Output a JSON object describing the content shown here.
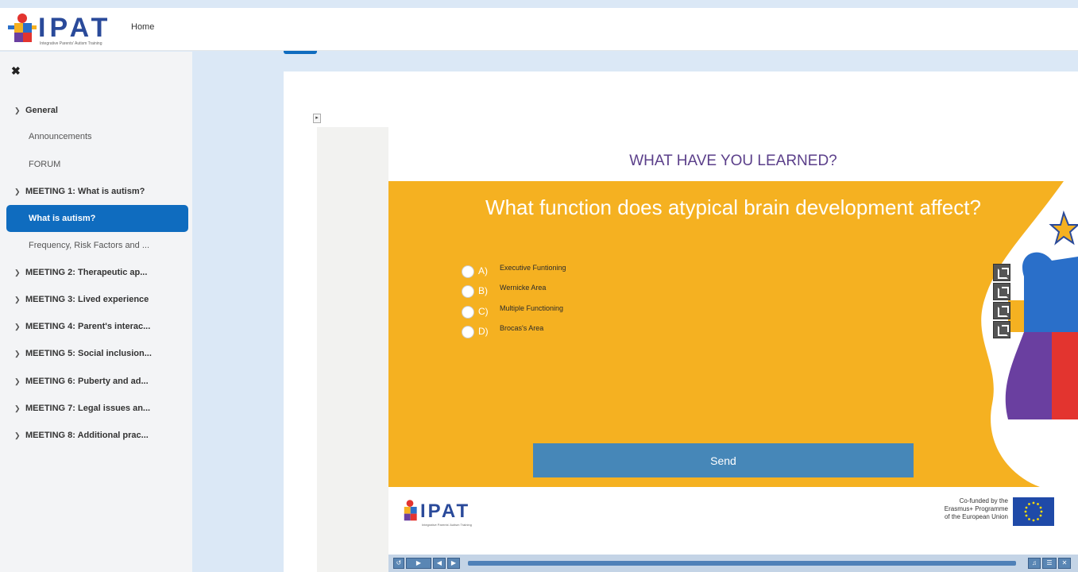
{
  "header": {
    "brand": "IPAT",
    "brand_sub": "Integrative Parents' Autism Training",
    "nav_home": "Home"
  },
  "sidebar": {
    "close_glyph": "✖",
    "sections": [
      {
        "label": "General",
        "expanded": true
      },
      {
        "label": "MEETING 1: What is autism?",
        "expanded": true
      },
      {
        "label": "MEETING 2: Therapeutic ap...",
        "expanded": true
      },
      {
        "label": "MEETING 3: Lived experience",
        "expanded": true
      },
      {
        "label": "MEETING 4: Parent's interac...",
        "expanded": true
      },
      {
        "label": "MEETING 5: Social inclusion...",
        "expanded": true
      },
      {
        "label": "MEETING 6: Puberty and ad...",
        "expanded": true
      },
      {
        "label": "MEETING 7: Legal issues an...",
        "expanded": true
      },
      {
        "label": "MEETING 8: Additional prac...",
        "expanded": true
      }
    ],
    "items": {
      "announcements": "Announcements",
      "forum": "FORUM",
      "what_is_autism": "What is autism?",
      "frequency": "Frequency, Risk Factors and ..."
    }
  },
  "slide": {
    "heading": "WHAT HAVE YOU LEARNED?",
    "question": "What function does atypical brain development affect?",
    "options": [
      {
        "letter": "A)",
        "text": "Executive Funtioning"
      },
      {
        "letter": "B)",
        "text": "Wernicke Area"
      },
      {
        "letter": "C)",
        "text": "Multiple Functioning"
      },
      {
        "letter": "D)",
        "text": "Brocas's Area"
      }
    ],
    "send_label": "Send",
    "footer_brand": "IPAT",
    "footer_brand_sub": "Integrative Parents' Autism Training",
    "eu_line1": "Co-funded by the",
    "eu_line2": "Erasmus+ Programme",
    "eu_line3": "of the European Union"
  },
  "colors": {
    "accent": "#0f6cbf",
    "slide_orange": "#f5b121",
    "heading_purple": "#5b3f8a",
    "send_button": "#4687b8"
  },
  "icons": {
    "sidebar_close": "close-icon",
    "section_toggle": "chevron-down-icon",
    "external": "external-link-icon",
    "expand_panel": "double-chevron-right-icon"
  }
}
